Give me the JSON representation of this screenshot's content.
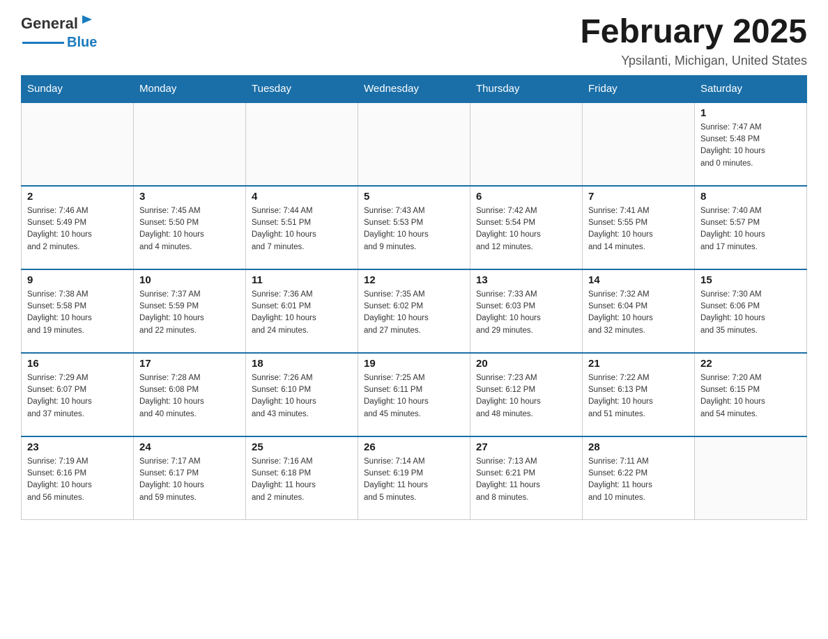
{
  "header": {
    "logo_general": "General",
    "logo_blue": "Blue",
    "title": "February 2025",
    "subtitle": "Ypsilanti, Michigan, United States"
  },
  "weekdays": [
    "Sunday",
    "Monday",
    "Tuesday",
    "Wednesday",
    "Thursday",
    "Friday",
    "Saturday"
  ],
  "weeks": [
    [
      {
        "day": "",
        "info": ""
      },
      {
        "day": "",
        "info": ""
      },
      {
        "day": "",
        "info": ""
      },
      {
        "day": "",
        "info": ""
      },
      {
        "day": "",
        "info": ""
      },
      {
        "day": "",
        "info": ""
      },
      {
        "day": "1",
        "info": "Sunrise: 7:47 AM\nSunset: 5:48 PM\nDaylight: 10 hours\nand 0 minutes."
      }
    ],
    [
      {
        "day": "2",
        "info": "Sunrise: 7:46 AM\nSunset: 5:49 PM\nDaylight: 10 hours\nand 2 minutes."
      },
      {
        "day": "3",
        "info": "Sunrise: 7:45 AM\nSunset: 5:50 PM\nDaylight: 10 hours\nand 4 minutes."
      },
      {
        "day": "4",
        "info": "Sunrise: 7:44 AM\nSunset: 5:51 PM\nDaylight: 10 hours\nand 7 minutes."
      },
      {
        "day": "5",
        "info": "Sunrise: 7:43 AM\nSunset: 5:53 PM\nDaylight: 10 hours\nand 9 minutes."
      },
      {
        "day": "6",
        "info": "Sunrise: 7:42 AM\nSunset: 5:54 PM\nDaylight: 10 hours\nand 12 minutes."
      },
      {
        "day": "7",
        "info": "Sunrise: 7:41 AM\nSunset: 5:55 PM\nDaylight: 10 hours\nand 14 minutes."
      },
      {
        "day": "8",
        "info": "Sunrise: 7:40 AM\nSunset: 5:57 PM\nDaylight: 10 hours\nand 17 minutes."
      }
    ],
    [
      {
        "day": "9",
        "info": "Sunrise: 7:38 AM\nSunset: 5:58 PM\nDaylight: 10 hours\nand 19 minutes."
      },
      {
        "day": "10",
        "info": "Sunrise: 7:37 AM\nSunset: 5:59 PM\nDaylight: 10 hours\nand 22 minutes."
      },
      {
        "day": "11",
        "info": "Sunrise: 7:36 AM\nSunset: 6:01 PM\nDaylight: 10 hours\nand 24 minutes."
      },
      {
        "day": "12",
        "info": "Sunrise: 7:35 AM\nSunset: 6:02 PM\nDaylight: 10 hours\nand 27 minutes."
      },
      {
        "day": "13",
        "info": "Sunrise: 7:33 AM\nSunset: 6:03 PM\nDaylight: 10 hours\nand 29 minutes."
      },
      {
        "day": "14",
        "info": "Sunrise: 7:32 AM\nSunset: 6:04 PM\nDaylight: 10 hours\nand 32 minutes."
      },
      {
        "day": "15",
        "info": "Sunrise: 7:30 AM\nSunset: 6:06 PM\nDaylight: 10 hours\nand 35 minutes."
      }
    ],
    [
      {
        "day": "16",
        "info": "Sunrise: 7:29 AM\nSunset: 6:07 PM\nDaylight: 10 hours\nand 37 minutes."
      },
      {
        "day": "17",
        "info": "Sunrise: 7:28 AM\nSunset: 6:08 PM\nDaylight: 10 hours\nand 40 minutes."
      },
      {
        "day": "18",
        "info": "Sunrise: 7:26 AM\nSunset: 6:10 PM\nDaylight: 10 hours\nand 43 minutes."
      },
      {
        "day": "19",
        "info": "Sunrise: 7:25 AM\nSunset: 6:11 PM\nDaylight: 10 hours\nand 45 minutes."
      },
      {
        "day": "20",
        "info": "Sunrise: 7:23 AM\nSunset: 6:12 PM\nDaylight: 10 hours\nand 48 minutes."
      },
      {
        "day": "21",
        "info": "Sunrise: 7:22 AM\nSunset: 6:13 PM\nDaylight: 10 hours\nand 51 minutes."
      },
      {
        "day": "22",
        "info": "Sunrise: 7:20 AM\nSunset: 6:15 PM\nDaylight: 10 hours\nand 54 minutes."
      }
    ],
    [
      {
        "day": "23",
        "info": "Sunrise: 7:19 AM\nSunset: 6:16 PM\nDaylight: 10 hours\nand 56 minutes."
      },
      {
        "day": "24",
        "info": "Sunrise: 7:17 AM\nSunset: 6:17 PM\nDaylight: 10 hours\nand 59 minutes."
      },
      {
        "day": "25",
        "info": "Sunrise: 7:16 AM\nSunset: 6:18 PM\nDaylight: 11 hours\nand 2 minutes."
      },
      {
        "day": "26",
        "info": "Sunrise: 7:14 AM\nSunset: 6:19 PM\nDaylight: 11 hours\nand 5 minutes."
      },
      {
        "day": "27",
        "info": "Sunrise: 7:13 AM\nSunset: 6:21 PM\nDaylight: 11 hours\nand 8 minutes."
      },
      {
        "day": "28",
        "info": "Sunrise: 7:11 AM\nSunset: 6:22 PM\nDaylight: 11 hours\nand 10 minutes."
      },
      {
        "day": "",
        "info": ""
      }
    ]
  ]
}
